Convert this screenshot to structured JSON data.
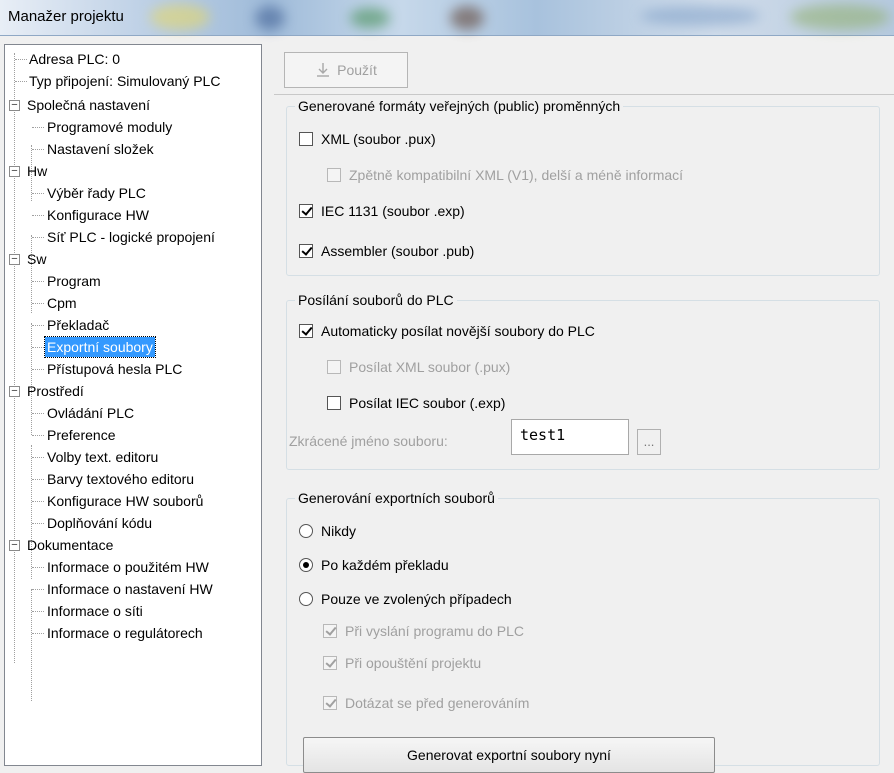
{
  "window": {
    "title": "Manažer projektu"
  },
  "tree": {
    "items": [
      {
        "label": "Adresa PLC: 0"
      },
      {
        "label": "Typ připojení: Simulovaný PLC"
      },
      {
        "label": "Společná nastavení"
      },
      {
        "label": "Programové moduly"
      },
      {
        "label": "Nastavení složek"
      },
      {
        "label": "Hw"
      },
      {
        "label": "Výběr řady PLC"
      },
      {
        "label": "Konfigurace HW"
      },
      {
        "label": "Síť PLC - logické propojení"
      },
      {
        "label": "Sw"
      },
      {
        "label": "Program"
      },
      {
        "label": "Cpm"
      },
      {
        "label": "Překladač"
      },
      {
        "label": "Exportní soubory"
      },
      {
        "label": "Přístupová hesla PLC"
      },
      {
        "label": "Prostředí"
      },
      {
        "label": "Ovládání PLC"
      },
      {
        "label": "Preference"
      },
      {
        "label": "Volby text. editoru"
      },
      {
        "label": "Barvy textového editoru"
      },
      {
        "label": "Konfigurace HW souborů"
      },
      {
        "label": "Doplňování kódu"
      },
      {
        "label": "Dokumentace"
      },
      {
        "label": "Informace o použitém HW"
      },
      {
        "label": "Informace o nastavení HW"
      },
      {
        "label": "Informace o síti"
      },
      {
        "label": "Informace o regulátorech"
      }
    ],
    "selected": "Exportní soubory"
  },
  "toolbar": {
    "apply_label": "Použít"
  },
  "public_formats": {
    "title": "Generované formáty veřejných (public) proměnných",
    "xml": {
      "label": "XML (soubor .pux)",
      "checked": false
    },
    "xml_v1": {
      "label": "Zpětně kompatibilní XML (V1), delší a méně informací",
      "checked": false
    },
    "iec": {
      "label": "IEC 1131 (soubor .exp)",
      "checked": true
    },
    "asm": {
      "label": "Assembler (soubor .pub)",
      "checked": true
    }
  },
  "send_files": {
    "title": "Posílání souborů do PLC",
    "auto_send": {
      "label": "Automaticky posílat novější soubory do PLC",
      "checked": true
    },
    "send_xml": {
      "label": "Posílat XML soubor (.pux)",
      "checked": false
    },
    "send_iec": {
      "label": "Posílat IEC soubor (.exp)",
      "checked": false
    },
    "short_name_label": "Zkrácené jméno souboru:",
    "short_name_value": "test1",
    "browse_label": "..."
  },
  "generate": {
    "title": "Generování exportních souborů",
    "never": {
      "label": "Nikdy",
      "checked": false
    },
    "after_each": {
      "label": "Po každém překladu",
      "checked": true
    },
    "selected_cases": {
      "label": "Pouze ve zvolených případech",
      "checked": false
    },
    "on_send": {
      "label": "Při vyslání programu do PLC",
      "checked": true
    },
    "on_leave": {
      "label": "Při opouštění projektu",
      "checked": true
    },
    "ask_before": {
      "label": "Dotázat se před generováním",
      "checked": true
    },
    "generate_now_label": "Generovat exportní soubory nyní"
  }
}
